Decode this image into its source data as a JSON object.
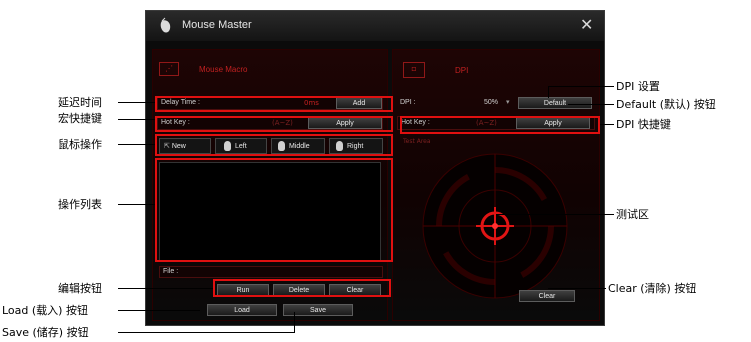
{
  "window": {
    "title": "Mouse Master",
    "close_icon": "close-icon"
  },
  "macro": {
    "heading": "Mouse Macro",
    "delay_label": "Delay Time :",
    "delay_value": "0ms",
    "add_label": "Add",
    "hotkey_label": "Hot Key :",
    "hotkey_hint": "(A~Z)",
    "apply_label": "Apply",
    "actions": {
      "new": "New",
      "left": "Left",
      "middle": "Middle",
      "right": "Right"
    },
    "file_label": "File :",
    "run_label": "Run",
    "delete_label": "Delete",
    "clear_label": "Clear",
    "load_label": "Load",
    "save_label": "Save"
  },
  "dpi": {
    "heading": "DPI",
    "dpi_label": "DPI :",
    "dpi_value": "50%",
    "default_label": "Default",
    "hotkey_label": "Hot Key :",
    "hotkey_hint": "(A~Z)",
    "apply_label": "Apply",
    "test_label": "Test Area",
    "clear_label": "Clear"
  },
  "annotations": {
    "left": {
      "delay": "延迟时间",
      "hotkey": "宏快捷键",
      "mouse_ops": "鼠标操作",
      "op_list": "操作列表",
      "edit_buttons": "编辑按钮",
      "load_button": "Load (载入) 按钮",
      "save_button": "Save (储存) 按钮"
    },
    "right": {
      "dpi_setting": "DPI 设置",
      "default_button": "Default (默认) 按钮",
      "dpi_hotkey": "DPI 快捷键",
      "test_area": "测试区",
      "clear_button": "Clear (清除) 按钮"
    }
  },
  "colors": {
    "highlight": "#e01010",
    "accent": "#c02020",
    "window_bg": "#0b0b0b"
  }
}
